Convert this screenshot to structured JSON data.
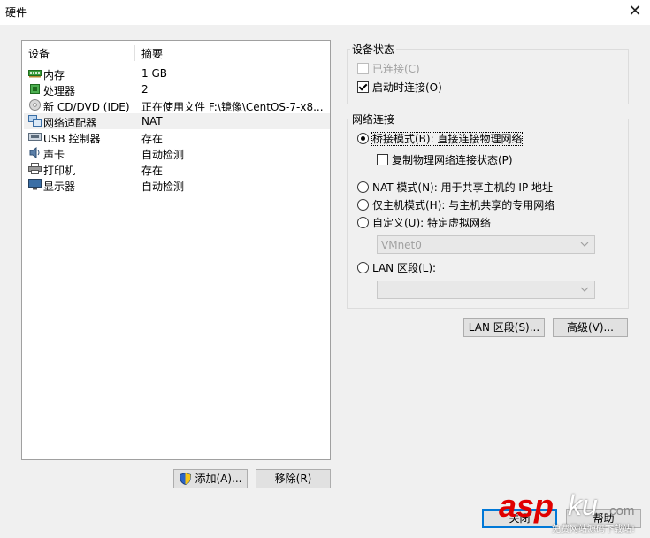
{
  "window": {
    "title": "硬件",
    "close_glyph": "✕"
  },
  "devices": {
    "header_device": "设备",
    "header_summary": "摘要",
    "items": [
      {
        "icon": "memory-icon",
        "name": "内存",
        "summary": "1 GB"
      },
      {
        "icon": "processor-icon",
        "name": "处理器",
        "summary": "2"
      },
      {
        "icon": "cd-dvd-icon",
        "name": "新 CD/DVD (IDE)",
        "summary": "正在使用文件 F:\\镜像\\CentOS-7-x8..."
      },
      {
        "icon": "network-adapter-icon",
        "name": "网络适配器",
        "summary": "NAT"
      },
      {
        "icon": "usb-icon",
        "name": "USB 控制器",
        "summary": "存在"
      },
      {
        "icon": "sound-card-icon",
        "name": "声卡",
        "summary": "自动检测"
      },
      {
        "icon": "printer-icon",
        "name": "打印机",
        "summary": "存在"
      },
      {
        "icon": "display-icon",
        "name": "显示器",
        "summary": "自动检测"
      }
    ],
    "add_label": "添加(A)...",
    "remove_label": "移除(R)"
  },
  "device_status": {
    "title": "设备状态",
    "connected_label": "已连接(C)",
    "connect_at_power_on_label": "启动时连接(O)"
  },
  "network": {
    "title": "网络连接",
    "bridged_label": "桥接模式(B): 直接连接物理网络",
    "replicate_label": "复制物理网络连接状态(P)",
    "nat_label": "NAT 模式(N): 用于共享主机的 IP 地址",
    "host_only_label": "仅主机模式(H): 与主机共享的专用网络",
    "custom_label": "自定义(U): 特定虚拟网络",
    "custom_value": "VMnet0",
    "lan_segment_label": "LAN 区段(L):",
    "lan_segment_value": "",
    "lan_segments_button": "LAN 区段(S)...",
    "advanced_button": "高级(V)..."
  },
  "footer": {
    "close_label": "关闭",
    "help_label": "帮助"
  },
  "watermark": {
    "brand": "asp",
    "brand_ku": "ku",
    "domain": ".com",
    "tagline": "免费网站源码下载站!"
  },
  "colors": {
    "focus_blue": "#0078d7",
    "watermark_red": "#e00000"
  }
}
